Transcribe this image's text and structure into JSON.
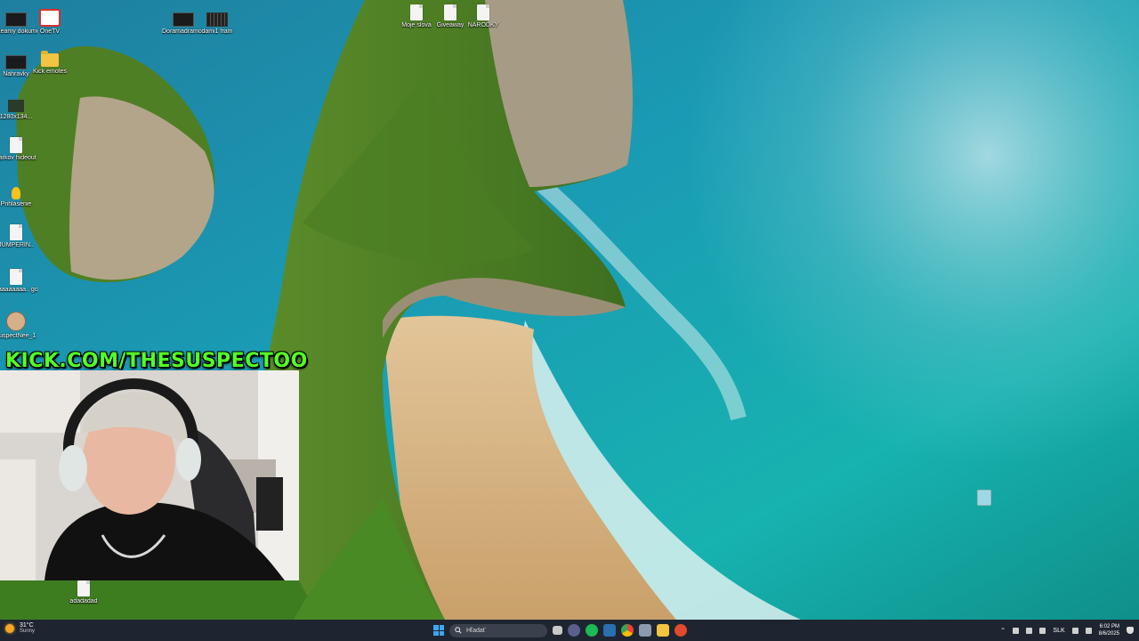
{
  "stream": {
    "url_text": "KICK.COM/THESUSPECTOO"
  },
  "desktop_icons": [
    {
      "label": "Steamy dokumenti",
      "glyph": "monitor-icon"
    },
    {
      "label": "OneTV",
      "glyph": "red-app-icon"
    },
    {
      "label": "Doramadramo rekord",
      "glyph": "video-file-icon"
    },
    {
      "label": "dami1 fram",
      "glyph": "film-icon"
    },
    {
      "label": "Moje slová",
      "glyph": "document-icon"
    },
    {
      "label": "Giveaway",
      "glyph": "document-icon"
    },
    {
      "label": "NÁRODKY",
      "glyph": "document-icon"
    },
    {
      "label": "Nahrávky",
      "glyph": "monitor-icon"
    },
    {
      "label": "Kick emotes",
      "glyph": "folder-icon"
    },
    {
      "label": "1280x134...",
      "glyph": "image-icon"
    },
    {
      "label": "Tarkov hideout",
      "glyph": "document-icon"
    },
    {
      "label": "Prihlásenie",
      "glyph": "lightbulb-icon"
    },
    {
      "label": "JUMPERIN..",
      "glyph": "document-icon"
    },
    {
      "label": "paaaaaaaa.. golf",
      "glyph": "document-icon"
    },
    {
      "label": "suspectNee_1",
      "glyph": "avatar-icon"
    },
    {
      "label": "adadadad",
      "glyph": "document-icon"
    }
  ],
  "taskbar": {
    "weather": {
      "temp": "31°C",
      "condition": "Sunny"
    },
    "search_placeholder": "Hľadať",
    "language": "SLK",
    "time": "6:02 PM",
    "date": "8/6/2025"
  },
  "colors": {
    "kick_green": "#54ff26",
    "taskbar_bg": "#1e2530",
    "accent": "#3ea7f0"
  }
}
